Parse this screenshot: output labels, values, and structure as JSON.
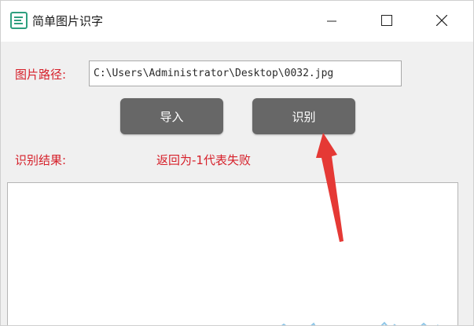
{
  "window": {
    "title": "简单图片识字",
    "icon": "app-icon",
    "controls": [
      "minimize-icon",
      "maximize-icon",
      "close-icon"
    ]
  },
  "form": {
    "path_label": "图片路径:",
    "path_value": "C:\\Users\\Administrator\\Desktop\\0032.jpg",
    "import_label": "导入",
    "recognize_label": "识别",
    "result_label": "识别结果:",
    "result_hint": "返回为-1代表失败",
    "result_text": ""
  },
  "colors": {
    "label_red": "#d6202a",
    "button_gray": "#676767",
    "arrow_red": "#e53935",
    "icon_green": "#2f9f7f"
  }
}
